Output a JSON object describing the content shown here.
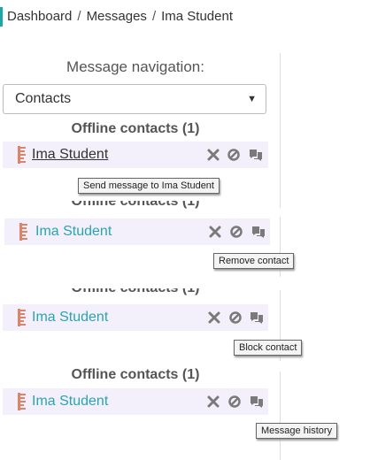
{
  "breadcrumb": {
    "items": [
      "Dashboard",
      "Messages",
      "Ima Student"
    ],
    "separator": "/"
  },
  "navigation": {
    "label": "Message navigation:",
    "select_value": "Contacts"
  },
  "contacts_header": "Offline contacts (1)",
  "contact_name": "Ima Student",
  "tooltips": {
    "send": "Send message to Ima Student",
    "remove": "Remove contact",
    "block": "Block contact",
    "history": "Message history"
  },
  "colors": {
    "accent": "#1aa7a7",
    "link": "#29a4b4",
    "row_bg": "#f3f0fb",
    "icon": "#7a7a7a"
  }
}
